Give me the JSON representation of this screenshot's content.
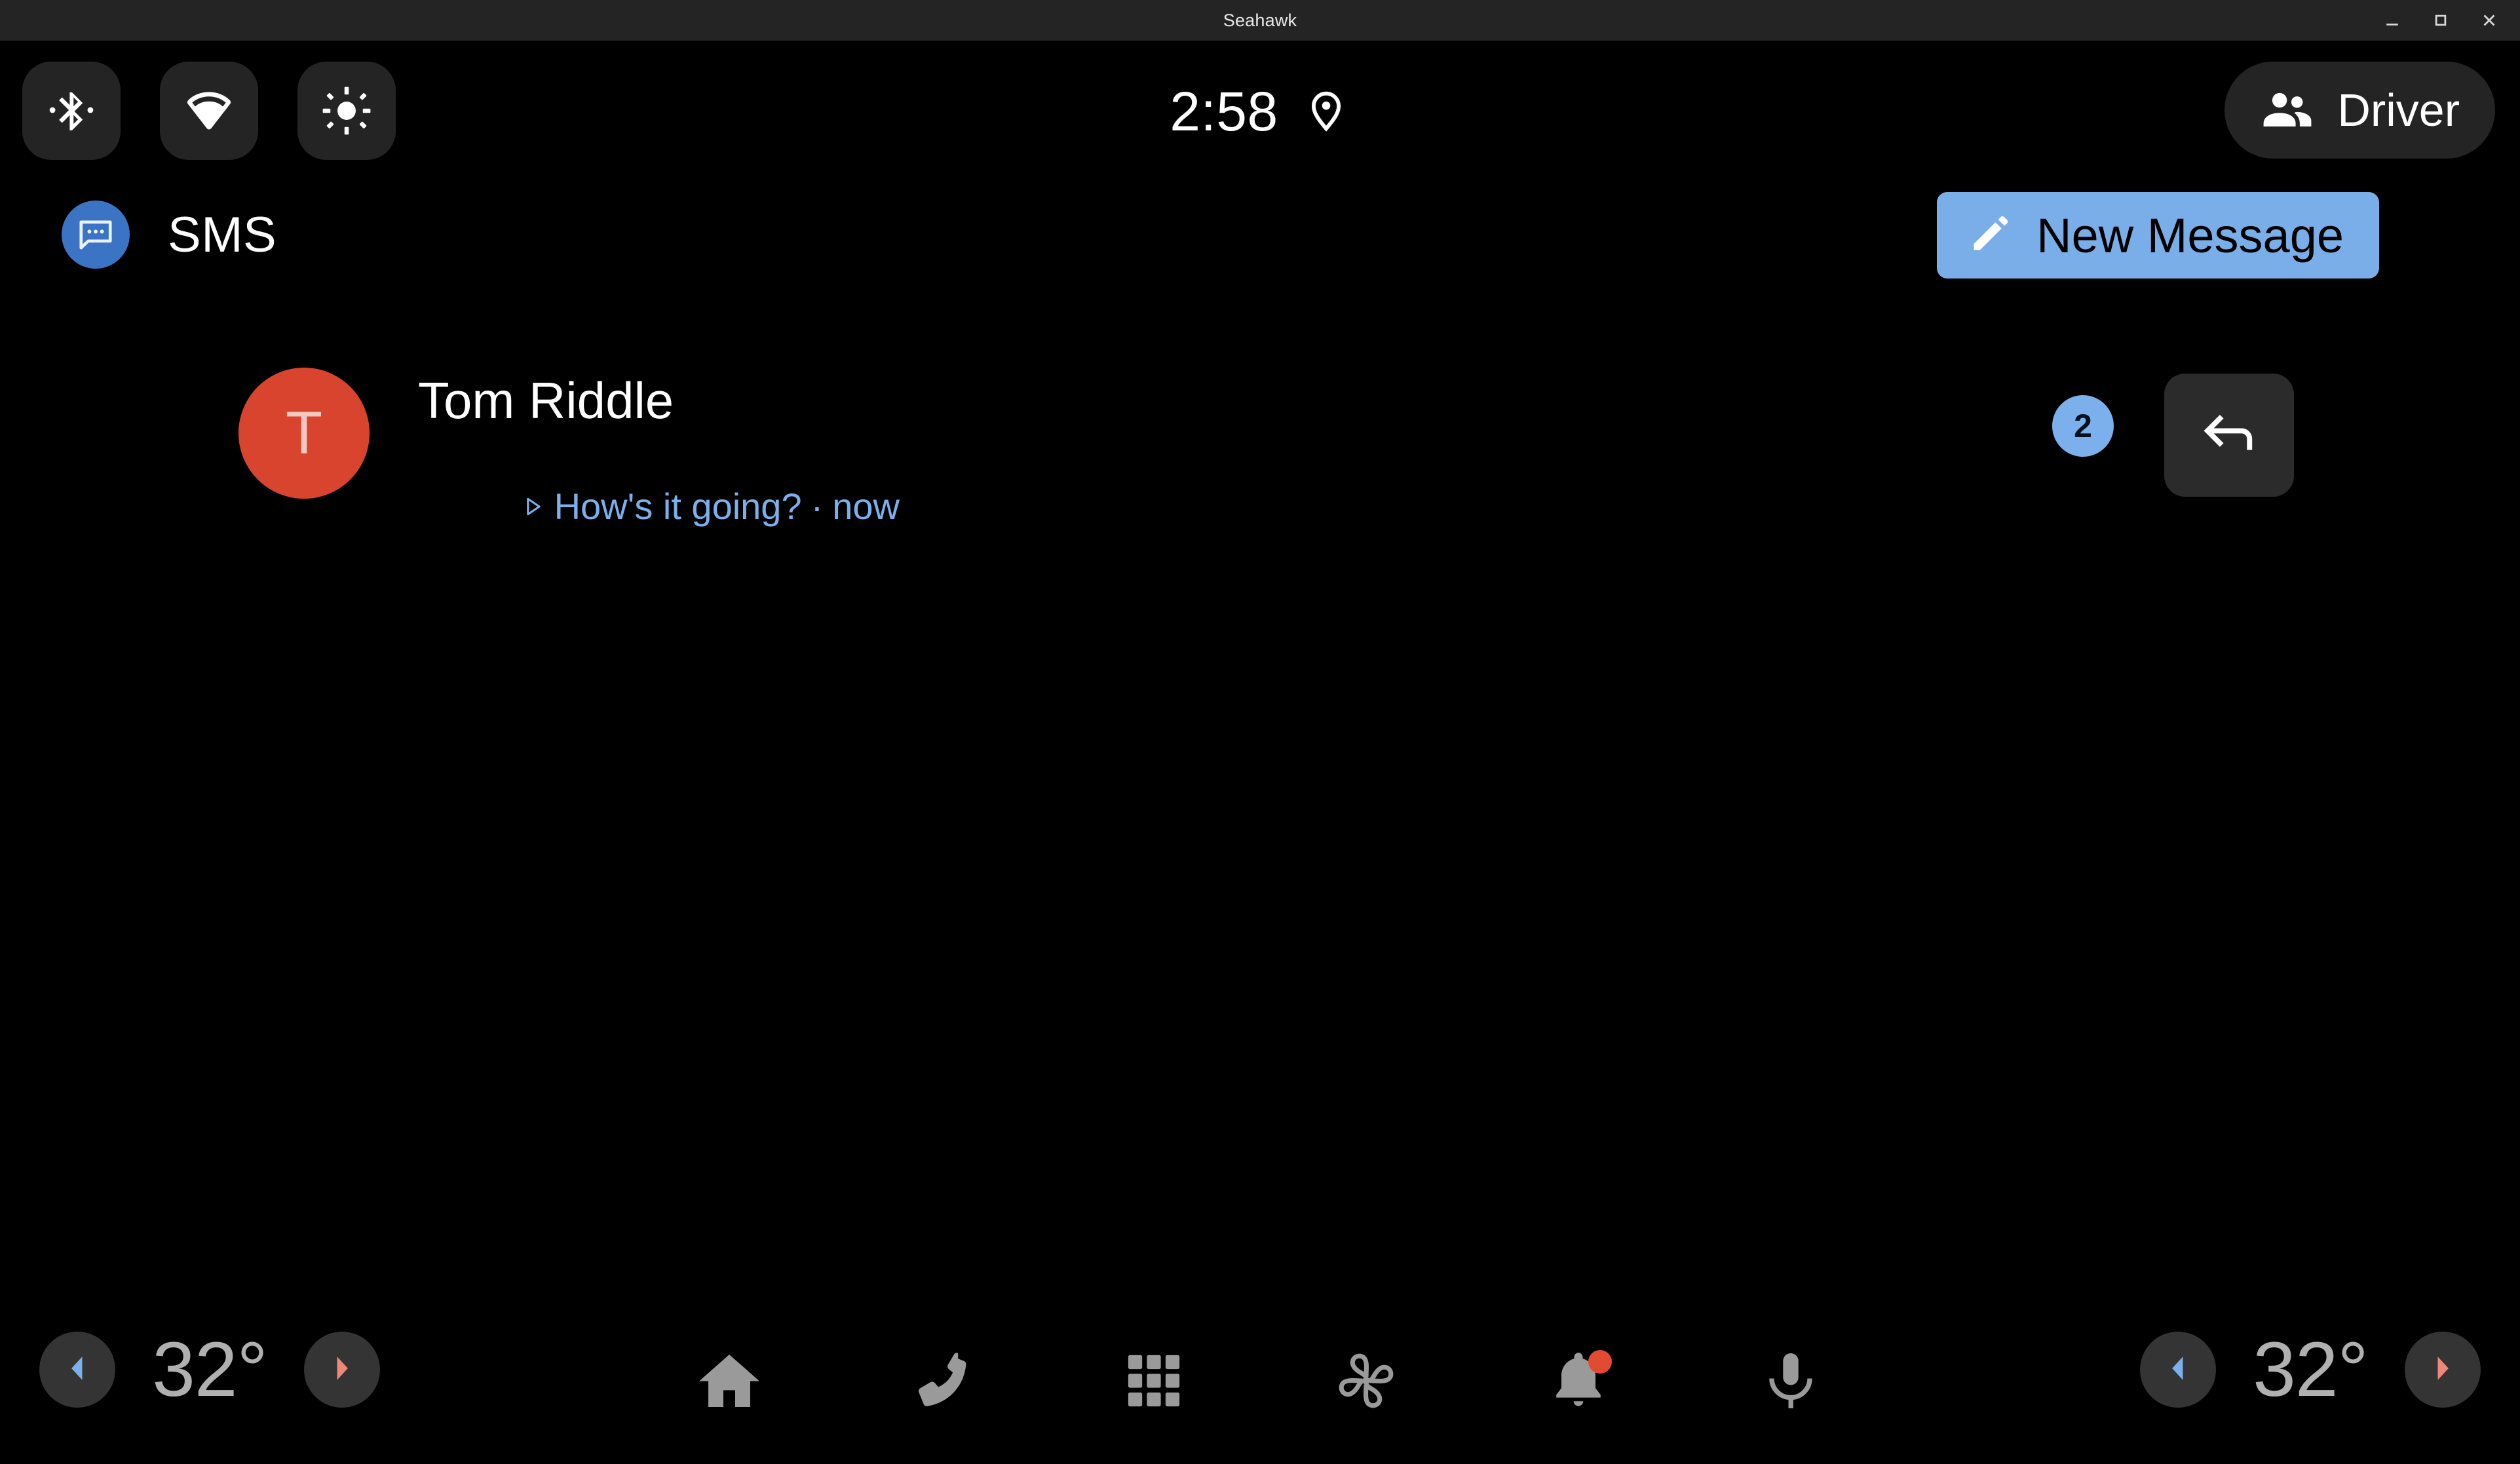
{
  "window": {
    "title": "Seahawk",
    "controls": [
      {
        "name": "minimize",
        "glyph": "minimize-icon"
      },
      {
        "name": "maximize",
        "glyph": "maximize-icon"
      },
      {
        "name": "close",
        "glyph": "close-icon"
      }
    ]
  },
  "statusbar": {
    "toggles": [
      {
        "name": "bluetooth-icon",
        "label": "Bluetooth",
        "state": "disabled"
      },
      {
        "name": "wifi-icon",
        "label": "Wi-Fi",
        "state": "connected"
      },
      {
        "name": "brightness-icon",
        "label": "Brightness",
        "state": "on"
      }
    ],
    "time": "2:58",
    "location_icon": "location-pin-icon",
    "profile": {
      "label": "Driver",
      "icon": "people-icon"
    }
  },
  "app": {
    "title": "SMS",
    "icon": "sms-chat-bubble-icon",
    "new_message": {
      "label": "New Message",
      "icon": "pencil-icon"
    }
  },
  "conversations": [
    {
      "avatar_letter": "T",
      "avatar_color": "#d9442f",
      "name": "Tom Riddle",
      "preview_icon": "play-triangle-icon",
      "preview": "How's it going?",
      "separator": "·",
      "timestamp": "now",
      "unread_count": "2",
      "reply_icon": "reply-arrow-icon"
    }
  ],
  "bottombar": {
    "left_temp": {
      "value": "32°",
      "decrease_icon": "chevron-left-icon",
      "increase_icon": "chevron-right-icon"
    },
    "right_temp": {
      "value": "32°",
      "decrease_icon": "chevron-left-icon",
      "increase_icon": "chevron-right-icon"
    },
    "nav": [
      {
        "name": "home-icon",
        "label": "Home"
      },
      {
        "name": "phone-icon",
        "label": "Phone"
      },
      {
        "name": "apps-grid-icon",
        "label": "Apps"
      },
      {
        "name": "fan-climate-icon",
        "label": "Climate"
      },
      {
        "name": "bell-notifications-icon",
        "label": "Notifications",
        "badge": true
      },
      {
        "name": "microphone-icon",
        "label": "Assistant"
      }
    ]
  },
  "colors": {
    "background": "#000000",
    "titlebar": "#242424",
    "accent_blue": "#7aaee8",
    "app_blue": "#3b74c4",
    "preview_blue": "#7cb0ec",
    "avatar_red": "#d9442f",
    "surface": "#242424",
    "cold_arrow": "#7cb0ec",
    "hot_arrow": "#ef8878",
    "nav_icon": "#9a9a9a",
    "notification_dot": "#e04b32"
  }
}
